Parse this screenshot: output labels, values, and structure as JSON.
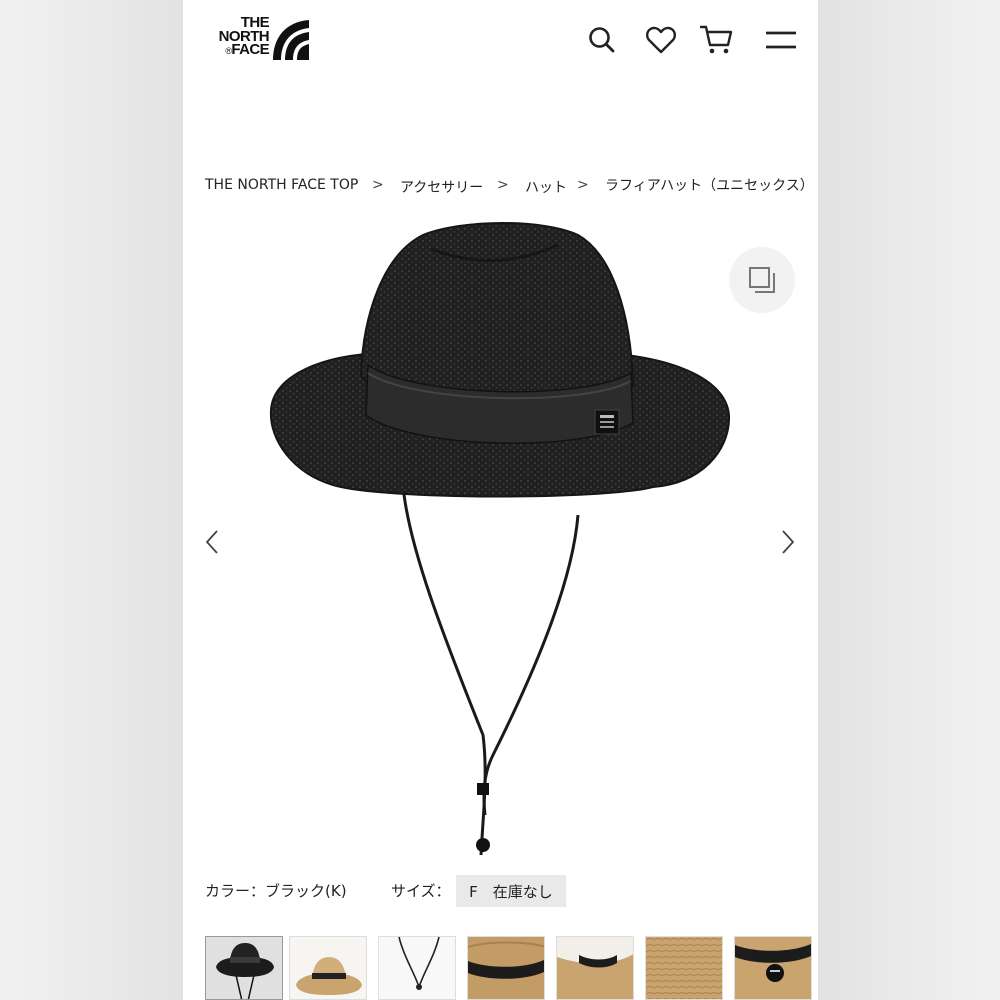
{
  "brand": {
    "logo_text": "THE NORTH FACE",
    "reg_mark": "®"
  },
  "header": {
    "icons": [
      "search-icon",
      "heart-icon",
      "cart-icon",
      "menu-icon"
    ]
  },
  "breadcrumb": {
    "items": [
      "THE NORTH FACE TOP",
      "アクセサリー",
      "ハット",
      "ラフィアハット（ユニセックス）"
    ],
    "separator": ">"
  },
  "product": {
    "color_label": "カラー：ブラック(K)",
    "size_label": "サイズ：",
    "size_option": "F　在庫なし"
  },
  "gallery": {
    "thumbnails": [
      "black-hat-front",
      "natural-hat-front",
      "chin-cord-detail",
      "band-detail",
      "brim-detail",
      "raffia-texture",
      "logo-tag-detail"
    ]
  },
  "colors": {
    "hat_black": "#1c1c1c",
    "hat_natural": "#c9a46f",
    "size_chip_bg": "#e9e9e9",
    "text": "#222222"
  }
}
